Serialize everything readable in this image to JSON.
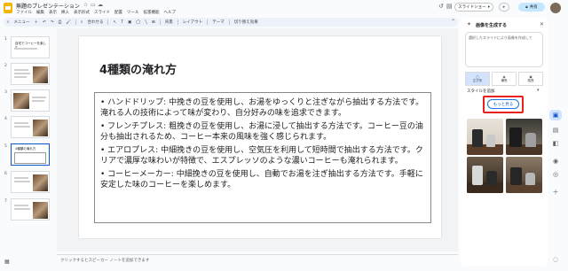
{
  "app": {
    "title": "無題のプレゼンテーション",
    "menu": [
      "ファイル",
      "編集",
      "表示",
      "挿入",
      "表示形式",
      "スライド",
      "配置",
      "ツール",
      "拡張機能",
      "ヘルプ"
    ]
  },
  "header": {
    "slideshow_label": "スライドショー",
    "share_label": "共有"
  },
  "toolbar": {
    "menu_label": "メニュー",
    "fit_label": "合わせる",
    "background_label": "背景",
    "layout_label": "レイアウト",
    "theme_label": "テーマ",
    "transition_label": "切り替え効果"
  },
  "filmstrip": {
    "active_index": 5,
    "slides": [
      {
        "num": "1",
        "title": "自宅でコーヒーを楽しむ"
      },
      {
        "num": "2",
        "title": ""
      },
      {
        "num": "3",
        "title": ""
      },
      {
        "num": "4",
        "title": ""
      },
      {
        "num": "5",
        "title": "4種類の淹れ方"
      },
      {
        "num": "6",
        "title": ""
      },
      {
        "num": "7",
        "title": ""
      }
    ]
  },
  "slide": {
    "title": "4種類の淹れ方",
    "bullets": [
      "• ハンドドリップ: 中挽きの豆を使用し、お湯をゆっくりと注ぎながら抽出する方法です。淹れる人の技術によって味が変わり、自分好みの味を追求できます。",
      "• フレンチプレス: 粗挽きの豆を使用し、お湯に浸して抽出する方法です。コーヒー豆の油分も抽出されるため、コーヒー本来の風味を強く感じられます。",
      "• エアロプレス: 中細挽きの豆を使用し、空気圧を利用して短時間で抽出する方法です。クリアで濃厚な味わいが特徴で、エスプレッソのような濃いコーヒーも淹れられます。",
      "• コーヒーメーカー: 中細挽きの豆を使用し、自動でお湯を注ぎ抽出する方法です。手軽に安定した味のコーヒーを楽しめます。"
    ]
  },
  "notes": {
    "placeholder": "クリックするとスピーカー ノートを追加できます"
  },
  "panel": {
    "title": "画像を生成する",
    "prompt_text": "選択したスライドにより画像を作成して",
    "types": [
      "正方形",
      "横長",
      "縦長"
    ],
    "style_label": "スタイルを追加",
    "more_button": "もっと見る",
    "highlight_color": "#e8211d"
  }
}
